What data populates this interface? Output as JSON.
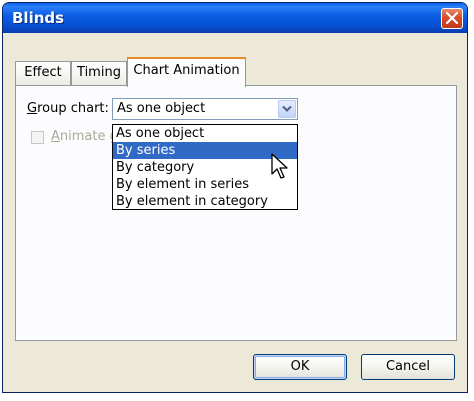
{
  "window": {
    "title": "Blinds"
  },
  "tabs": [
    {
      "label": "Effect"
    },
    {
      "label": "Timing"
    },
    {
      "label": "Chart Animation"
    }
  ],
  "group_chart": {
    "label_underlined": "G",
    "label_rest": "roup chart:",
    "value": "As one object",
    "options": [
      {
        "label": "As one object",
        "selected": false
      },
      {
        "label": "By series",
        "selected": true
      },
      {
        "label": "By category",
        "selected": false
      },
      {
        "label": "By element in series",
        "selected": false
      },
      {
        "label": "By element in category",
        "selected": false
      }
    ]
  },
  "animate_checkbox": {
    "label_underlined": "A",
    "label_rest": "nimate g",
    "checked": false,
    "enabled": false
  },
  "buttons": {
    "ok": "OK",
    "cancel": "Cancel"
  },
  "colors": {
    "titlebar": "#0a5ef1",
    "selection": "#316ac5",
    "close_button": "#d84b2c",
    "dialog_face": "#ece9d8"
  }
}
